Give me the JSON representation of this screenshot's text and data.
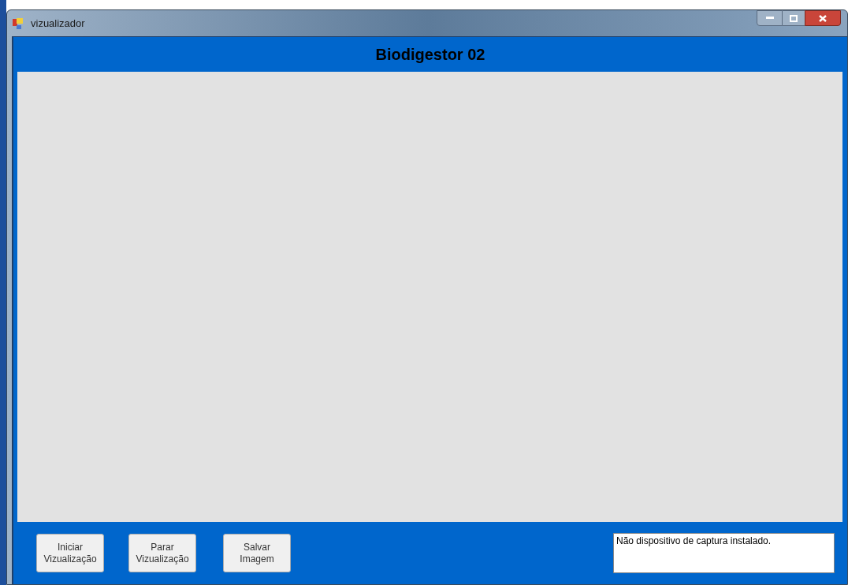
{
  "window": {
    "title": "vizualizador"
  },
  "header": {
    "title": "Biodigestor 02"
  },
  "buttons": [
    {
      "lines": [
        "Iniciar",
        "Vizualização"
      ]
    },
    {
      "lines": [
        "Parar",
        "Vizualização"
      ]
    },
    {
      "lines": [
        "Salvar",
        "Imagem"
      ]
    }
  ],
  "status_box": {
    "value": "Não dispositivo de captura instalado."
  }
}
